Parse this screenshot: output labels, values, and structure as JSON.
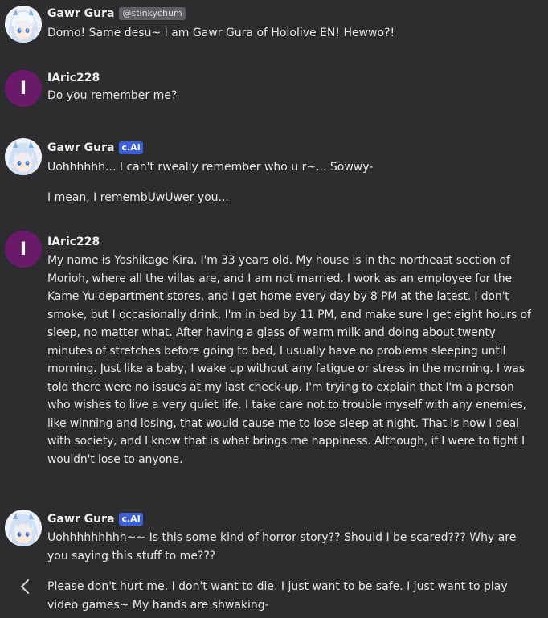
{
  "messages": [
    {
      "name": "Gawr Gura",
      "handle": "@stinkychum",
      "text": "Domo! Same desu~ I am Gawr Gura of Hololive EN! Hewwo?!"
    },
    {
      "name": "IAric228",
      "avatar_initial": "I",
      "text": "Do you remember me?"
    },
    {
      "name": "Gawr Gura",
      "badge": "c.AI",
      "text": "Uohhhhhh... I can't rweally remember who u r~... Sowwy-",
      "text2": "I mean, I remembUwUwer you..."
    },
    {
      "name": "IAric228",
      "avatar_initial": "I",
      "text": "My name is Yoshikage Kira. I'm 33 years old. My house is in the northeast section of Morioh, where all the villas are, and I am not married. I work as an employee for the Kame Yu department stores, and I get home every day by 8 PM at the latest. I don't smoke, but I occasionally drink. I'm in bed by 11 PM, and make sure I get eight hours of sleep, no matter what. After having a glass of warm milk and doing about twenty minutes of stretches before going to bed, I usually have no problems sleeping until morning. Just like a baby, I wake up without any fatigue or stress in the morning. I was told there were no issues at my last check-up. I'm trying to explain that I'm a person who wishes to live a very quiet life. I take care not to trouble myself with any enemies, like winning and losing, that would cause me to lose sleep at night. That is how I deal with society, and I know that is what brings me happiness. Although, if I were to fight I wouldn't lose to anyone."
    },
    {
      "name": "Gawr Gura",
      "badge": "c.AI",
      "text": "Uohhhhhhhhh~~ Is this some kind of horror story?? Should I be scared??? Why are you saying this stuff to me???",
      "text2": "Please don't hurt me. I don't want to die. I just want to be safe. I just want to play video games~ My hands are shwaking-"
    }
  ],
  "nav": {
    "back_icon": "chevron-left-icon"
  },
  "colors": {
    "background": "#2d2d2f",
    "user_avatar": "#6b1a6b",
    "ai_badge": "#3b5fd9",
    "handle_tag": "#5d5f63"
  }
}
